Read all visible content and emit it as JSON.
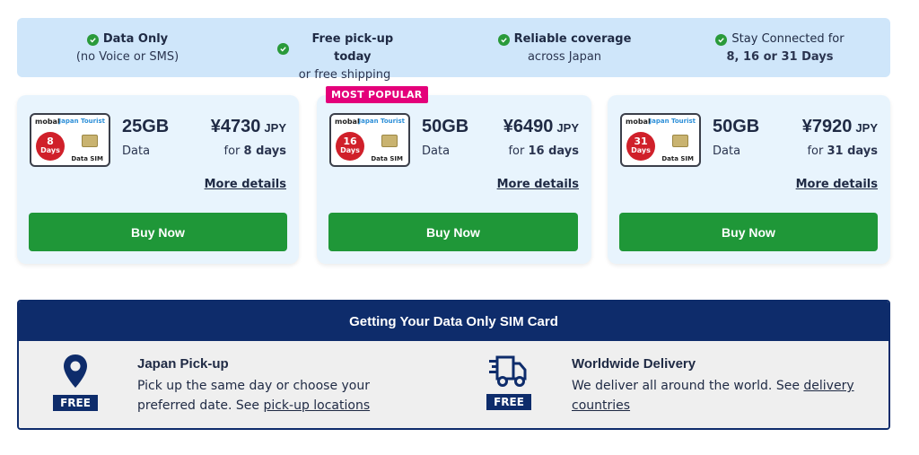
{
  "features": [
    {
      "title": "Data Only",
      "sub": "(no Voice or SMS)",
      "bold_title": true
    },
    {
      "title": "Free pick-up today",
      "sub": "or free shipping",
      "bold_title": true
    },
    {
      "title": "Reliable coverage",
      "sub": "across Japan",
      "bold_title": true
    },
    {
      "title": "Stay Connected for",
      "sub": "8, 16 or 31 Days",
      "bold_title": false
    }
  ],
  "popular_label": "MOST POPULAR",
  "plans": [
    {
      "sim_brand": "mobal",
      "sim_tag": "Japan Tourist",
      "sim_days_n": "8",
      "sim_days_d": "Days",
      "sim_type": "Data SIM",
      "gb": "25GB",
      "data_label": "Data",
      "price": "¥4730",
      "currency": "JPY",
      "for_prefix": "for",
      "days_text": "8 days",
      "more": "More details",
      "buy": "Buy Now"
    },
    {
      "sim_brand": "mobal",
      "sim_tag": "Japan Tourist",
      "sim_days_n": "16",
      "sim_days_d": "Days",
      "sim_type": "Data SIM",
      "gb": "50GB",
      "data_label": "Data",
      "price": "¥6490",
      "currency": "JPY",
      "for_prefix": "for",
      "days_text": "16 days",
      "more": "More details",
      "buy": "Buy Now"
    },
    {
      "sim_brand": "mobal",
      "sim_tag": "Japan Tourist",
      "sim_days_n": "31",
      "sim_days_d": "Days",
      "sim_type": "Data SIM",
      "gb": "50GB",
      "data_label": "Data",
      "price": "¥7920",
      "currency": "JPY",
      "for_prefix": "for",
      "days_text": "31 days",
      "more": "More details",
      "buy": "Buy Now"
    }
  ],
  "delivery": {
    "heading": "Getting Your Data Only SIM Card",
    "pickup": {
      "badge": "FREE",
      "title": "Japan Pick-up",
      "line1": "Pick up the same day or choose your",
      "line2_prefix": "preferred date. See ",
      "link": "pick-up locations"
    },
    "worldwide": {
      "badge": "FREE",
      "title": "Worldwide Delivery",
      "line1_prefix": "We deliver all around the world. See ",
      "link1": "delivery",
      "link2": "countries"
    }
  },
  "colors": {
    "accent_green": "#1f9738",
    "navy": "#0e2c6b",
    "popular_pink": "#e4007a",
    "feature_bg": "#cfe6fa",
    "card_bg": "#e8f4fd"
  }
}
